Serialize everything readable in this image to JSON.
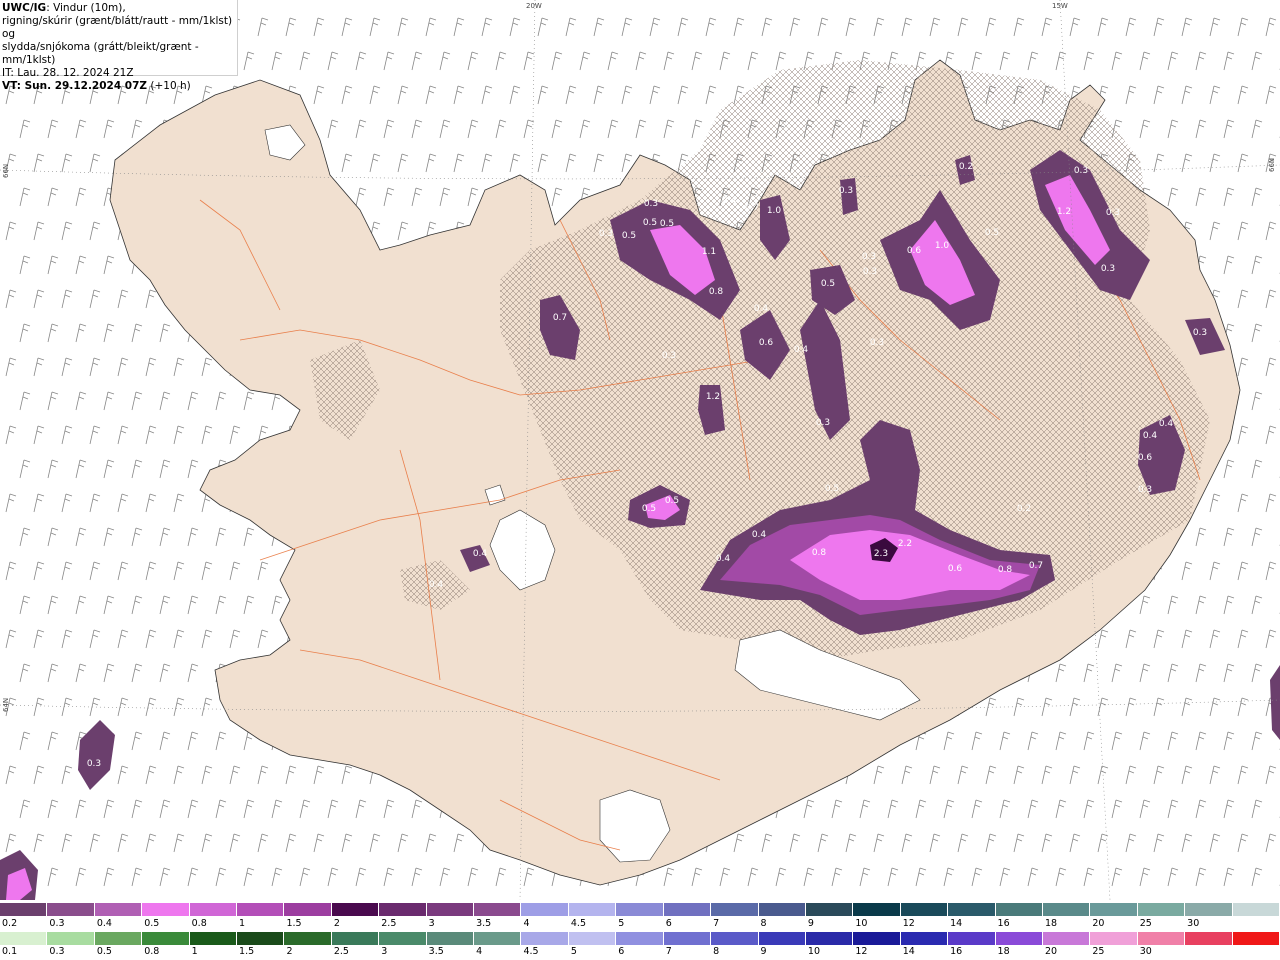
{
  "header": {
    "line1_bold": "UWC/IG",
    "line1_rest": ": Vindur (10m),",
    "line2": "rigning/skúrir (grænt/blátt/rautt - mm/1klst) og",
    "line3": "slydda/snjókoma (grátt/bleikt/grænt - mm/1klst)",
    "line4": "IT: Lau. 28. 12. 2024 21Z",
    "line5_bold": "VT: Sun. 29.12.2024 07Z",
    "line5_rest": " (+10 h)"
  },
  "grid_labels": {
    "lon": [
      "20W",
      "15W"
    ],
    "lat": [
      "66N",
      "64N"
    ]
  },
  "colors": {
    "land": "#f1e0d0",
    "sea": "#ffffff",
    "roads": "#e8743c",
    "coast": "#333333",
    "snow_low": "#6b3f6d",
    "snow_mid": "#a24aa6",
    "snow_high": "#ee77ee",
    "snow_peak": "#3a0a3e"
  },
  "precip_labels": [
    {
      "t": "0.3"
    },
    {
      "t": "0.5"
    },
    {
      "t": "0.5"
    },
    {
      "t": "0.3"
    },
    {
      "t": "0.5"
    },
    {
      "t": "0.4"
    },
    {
      "t": "1.0"
    },
    {
      "t": "0.7"
    },
    {
      "t": "1.1"
    },
    {
      "t": "0.8"
    },
    {
      "t": "0.3"
    },
    {
      "t": "0.4"
    },
    {
      "t": "0.6"
    },
    {
      "t": "0.4"
    },
    {
      "t": "0.5"
    },
    {
      "t": "0.3"
    },
    {
      "t": "0.3"
    },
    {
      "t": "0.6"
    },
    {
      "t": "1.0"
    },
    {
      "t": "0.5"
    },
    {
      "t": "0.3"
    },
    {
      "t": "0.2"
    },
    {
      "t": "1.2"
    },
    {
      "t": "0.3"
    },
    {
      "t": "0.3"
    },
    {
      "t": "0.3"
    },
    {
      "t": "0.7"
    },
    {
      "t": "1.2"
    },
    {
      "t": "0.3"
    },
    {
      "t": "0.5"
    },
    {
      "t": "0.5"
    },
    {
      "t": "0.5"
    },
    {
      "t": "0.4"
    },
    {
      "t": "0.4"
    },
    {
      "t": "0.4"
    },
    {
      "t": "0.4"
    },
    {
      "t": "0.8"
    },
    {
      "t": "2.3"
    },
    {
      "t": "2.2"
    },
    {
      "t": "0.6"
    },
    {
      "t": "0.8"
    },
    {
      "t": "0.7"
    },
    {
      "t": "0.4"
    },
    {
      "t": "0.6"
    },
    {
      "t": "0.4"
    },
    {
      "t": "0.3"
    },
    {
      "t": "0.3"
    },
    {
      "t": "0.3"
    },
    {
      "t": "0.2"
    },
    {
      "t": "0.3"
    }
  ],
  "legend_snow": {
    "colors": [
      "#6b3f6d",
      "#8a4d8c",
      "#b05fb4",
      "#ee77ee",
      "#d066d6",
      "#b34eb8",
      "#9c3da0",
      "#4a0a4e",
      "#6a2a6e",
      "#7a3a7e",
      "#8a4a8e",
      "#9e9ee6",
      "#b4b4ee",
      "#8a8ad6",
      "#7070c0",
      "#5a6aa8",
      "#4a5a8e",
      "#2a4a5a",
      "#0a3a4a",
      "#1a4a5a",
      "#2a5a6a",
      "#4a7a7a",
      "#5a8a8a",
      "#6a9a9a",
      "#7aaaa0",
      "#8aaaa8",
      "#c8d8d8"
    ],
    "labels": [
      "0.2",
      "0.3",
      "0.4",
      "0.5",
      "0.8",
      "1",
      "1.5",
      "2",
      "2.5",
      "3",
      "3.5",
      "4",
      "4.5",
      "5",
      "6",
      "7",
      "8",
      "9",
      "10",
      "12",
      "14",
      "16",
      "18",
      "20",
      "25",
      "30"
    ]
  },
  "legend_rain": {
    "colors": [
      "#d8f0d0",
      "#a8dca0",
      "#6aa860",
      "#3a8a3a",
      "#1a5a1a",
      "#1a4a1a",
      "#2a6a2a",
      "#3a7a5a",
      "#4a8a6a",
      "#5a8a7a",
      "#6a9a8a",
      "#a8a8e8",
      "#c0c0f0",
      "#9090e0",
      "#7070d0",
      "#5a5ac8",
      "#3a3ab8",
      "#2a2aa8",
      "#1a1a98",
      "#2a2ab0",
      "#5a3ac8",
      "#8a4ad8",
      "#c878d8",
      "#f0a0d8",
      "#f080a8",
      "#e84060",
      "#f01818"
    ],
    "labels": [
      "0.1",
      "0.3",
      "0.5",
      "0.8",
      "1",
      "1.5",
      "2",
      "2.5",
      "3",
      "3.5",
      "4",
      "4.5",
      "5",
      "6",
      "7",
      "8",
      "9",
      "10",
      "12",
      "14",
      "16",
      "18",
      "20",
      "25",
      "30"
    ]
  }
}
